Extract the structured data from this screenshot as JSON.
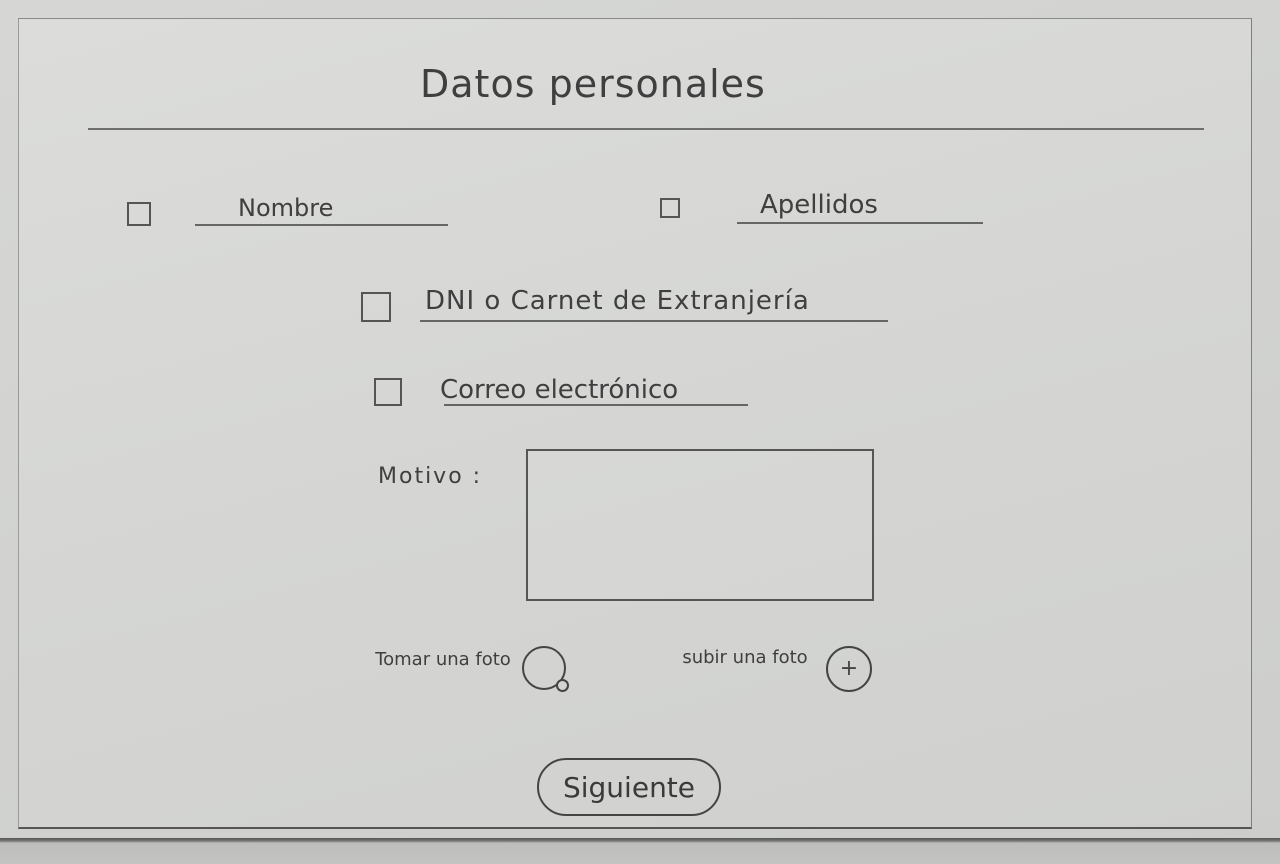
{
  "form": {
    "title": "Datos personales",
    "fields": {
      "nombre": "Nombre",
      "apellidos": "Apellidos",
      "documento": "DNI o Carnet de Extranjería",
      "correo": "Correo electrónico"
    },
    "motivo_label": "Motivo :",
    "motivo_value": "",
    "camera_label": "Tomar una foto",
    "upload_label": "subir una foto",
    "upload_symbol": "+",
    "next_label": "Siguiente"
  },
  "icons": {
    "camera": "camera-icon",
    "upload": "plus-circle-icon"
  }
}
